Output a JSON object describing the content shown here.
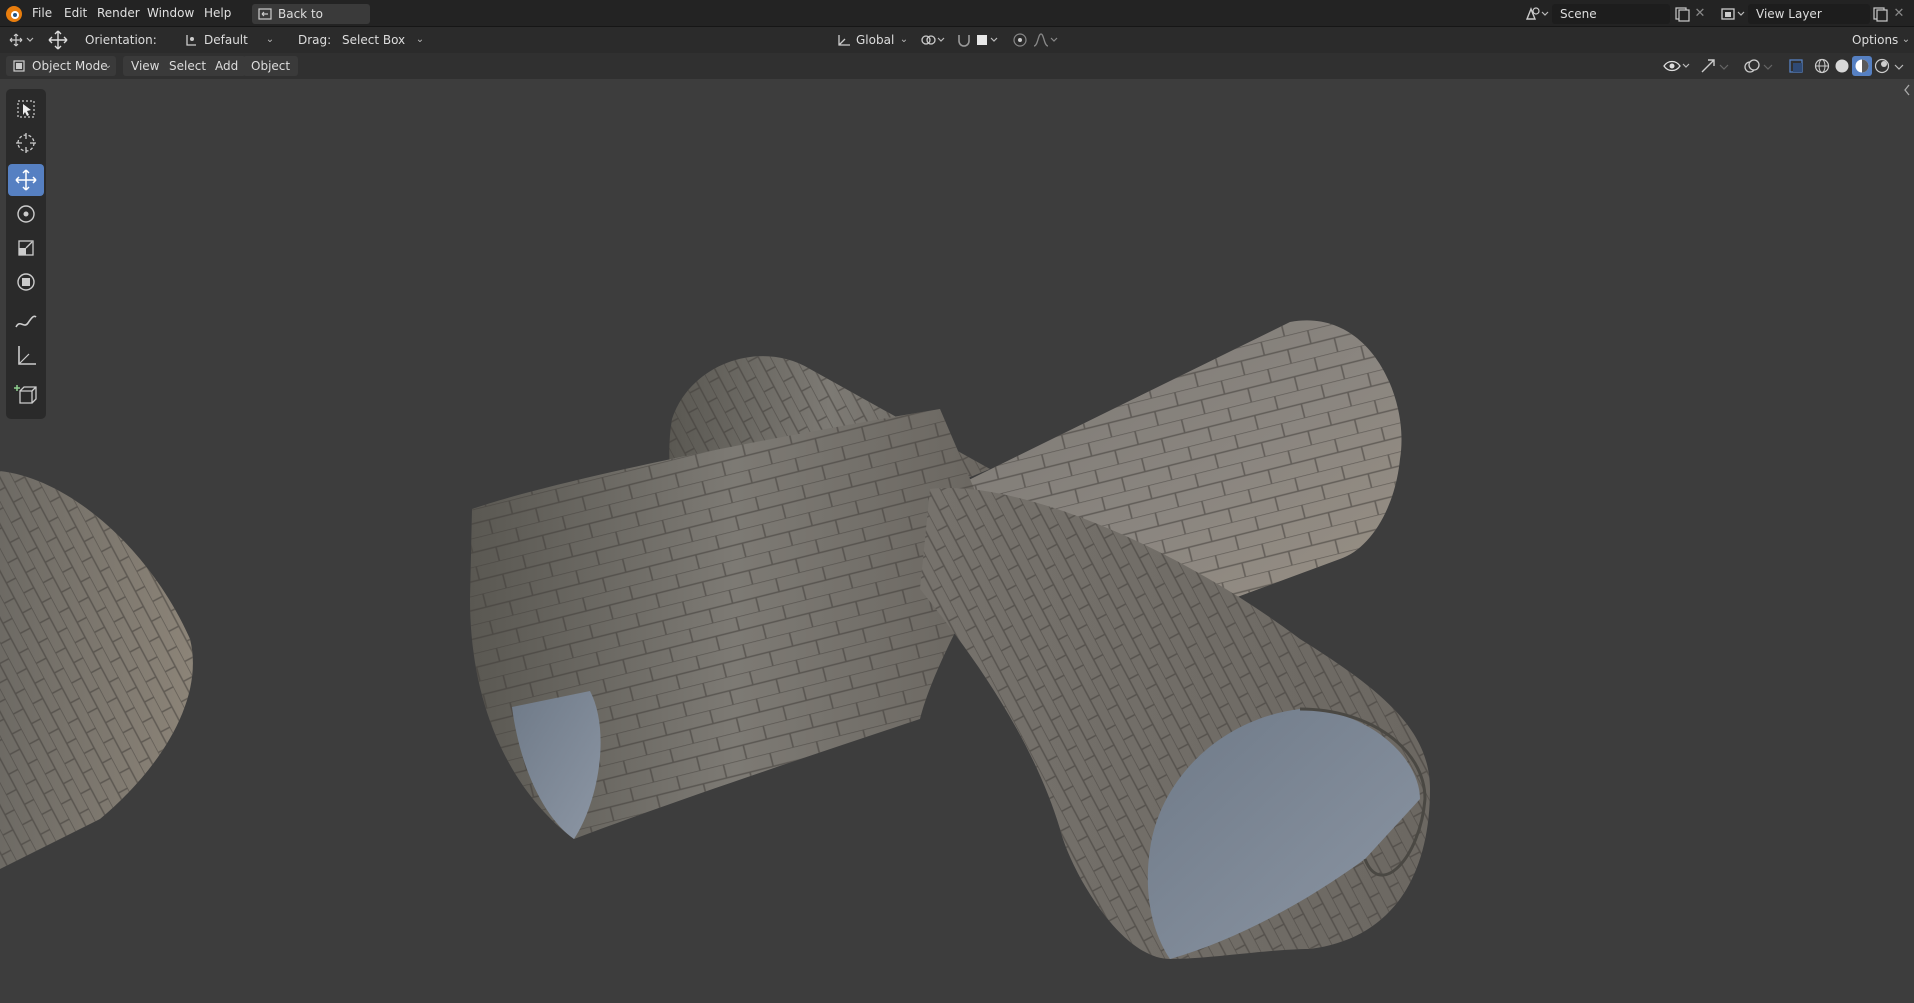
{
  "menu": {
    "items": [
      "File",
      "Edit",
      "Render",
      "Window",
      "Help"
    ],
    "back_button": "Back to Previous",
    "scene_value": "Scene",
    "view_layer_value": "View Layer"
  },
  "tool_header": {
    "orientation_label": "Orientation:",
    "orientation_value": "Default",
    "drag_label": "Drag:",
    "drag_value": "Select Box",
    "transform_orientation_value": "Global",
    "options_label": "Options"
  },
  "viewport_header": {
    "mode_value": "Object Mode",
    "menus": [
      "View",
      "Select",
      "Add",
      "Object"
    ]
  },
  "toolbar": {
    "tools": [
      "select-box",
      "cursor",
      "move",
      "rotate",
      "scale",
      "transform",
      "annotate",
      "measure",
      "add-cube"
    ],
    "active_tool": "move"
  },
  "colors": {
    "accent": "#5680c2",
    "topbar_bg": "#232323",
    "viewport_bg": "#3d3d3d"
  }
}
